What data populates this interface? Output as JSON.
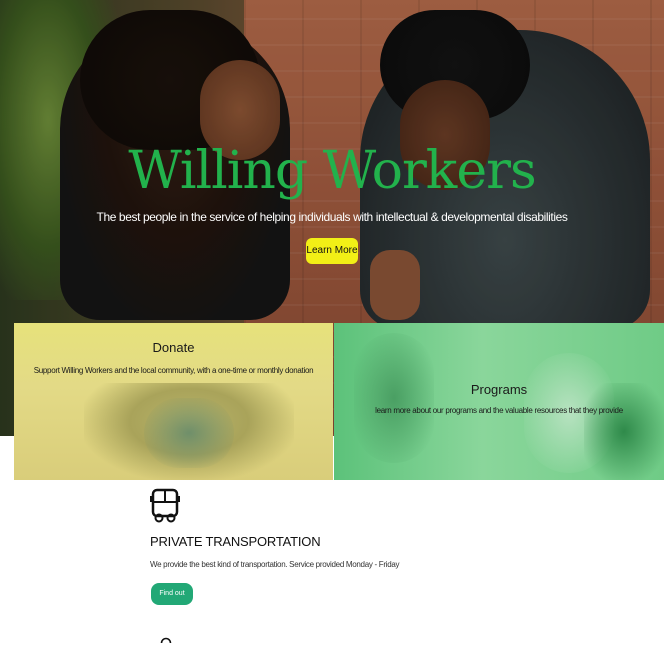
{
  "hero": {
    "title": "Willing Workers",
    "subtitle": "The best people in the service of helping individuals with intellectual & developmental disabilities",
    "button_label": "Learn More",
    "title_color": "#22b24c",
    "button_color": "#f2ef16"
  },
  "cards": {
    "donate": {
      "title": "Donate",
      "text": "Support Willing Workers and the local community, with a one-time or monthly donation"
    },
    "programs": {
      "title": "Programs",
      "text": "learn more about our programs and the valuable resources that they provide"
    }
  },
  "service": {
    "icon": "bus-icon",
    "title": "PRIVATE TRANSPORTATION",
    "text": "We provide the best kind of transportation. Service provided Monday - Friday",
    "button_label": "Find out more",
    "button_color": "#22a876"
  },
  "next_section": {
    "icon": "circle-icon"
  }
}
